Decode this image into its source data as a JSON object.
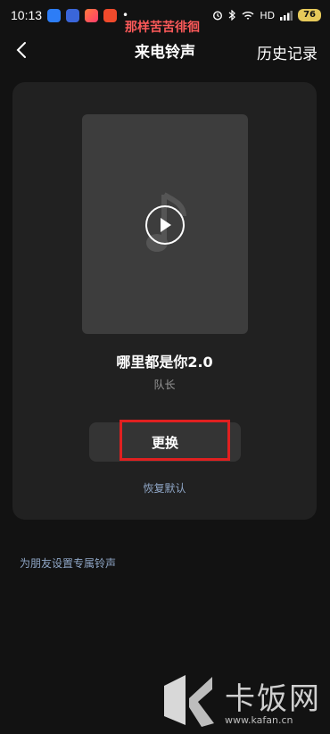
{
  "status_bar": {
    "time": "10:13",
    "dot": "•",
    "signal_text": "HD",
    "battery": "76"
  },
  "watermark_top": "那样苦苦徘徊",
  "header": {
    "title": "来电铃声",
    "history": "历史记录"
  },
  "song": {
    "title": "哪里都是你2.0",
    "artist": "队长"
  },
  "actions": {
    "change_label": "更换",
    "restore_label": "恢复默认"
  },
  "friend_link": "为朋友设置专属铃声",
  "watermark": {
    "brand": "卡饭网",
    "url": "www.kafan.cn"
  }
}
